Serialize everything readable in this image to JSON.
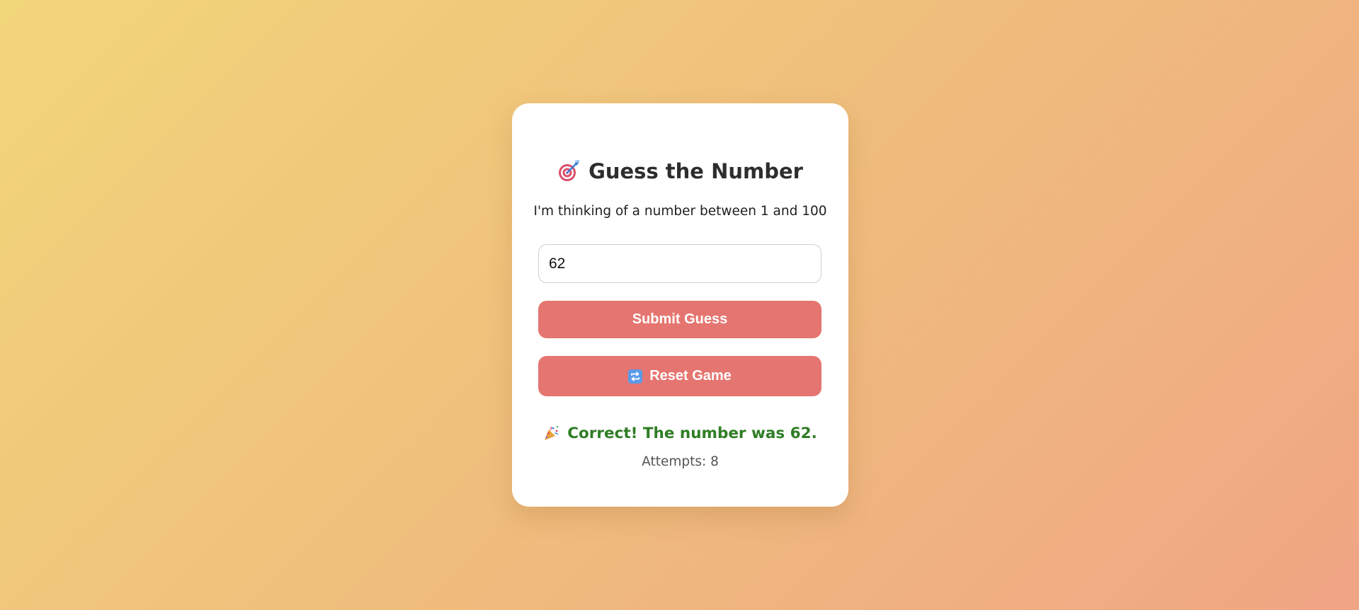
{
  "game": {
    "title": "Guess the Number",
    "title_icon": "direct-hit-target-icon",
    "subtitle": "I'm thinking of a number between 1 and 100",
    "guess_input_value": "62",
    "submit_label": "Submit Guess",
    "reset_label": "Reset Game",
    "reset_icon": "repeat-arrows-icon",
    "result_icon": "party-popper-icon",
    "result_message": "Correct! The number was 62.",
    "attempts_text": "Attempts: 8"
  },
  "colors": {
    "button": "#e57570",
    "success": "#2f7d25",
    "background_start": "#f2d67a",
    "background_end": "#f0a584"
  }
}
